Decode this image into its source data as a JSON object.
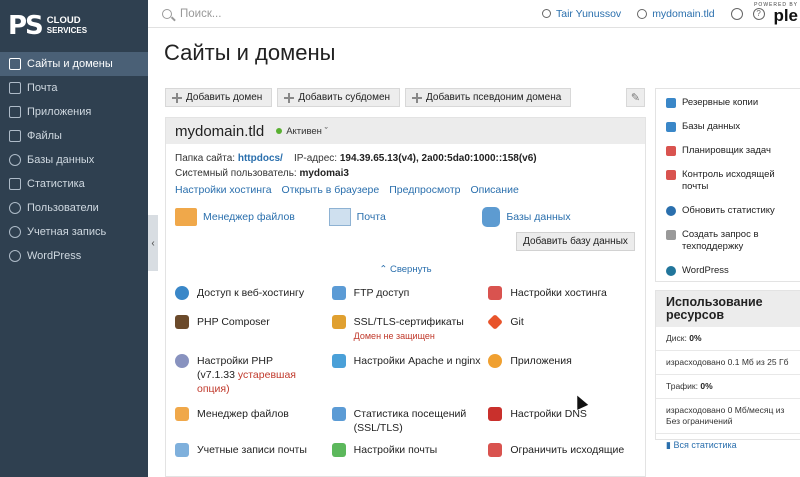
{
  "brand": {
    "logo_mark": "PS",
    "line1": "CLOUD",
    "line2": "SERVICES",
    "plesk_small": "POWERED BY",
    "plesk_big": "ple"
  },
  "sidebar": {
    "items": [
      {
        "label": "Сайты и домены",
        "icon": "monitor-icon",
        "active": true
      },
      {
        "label": "Почта",
        "icon": "mail-icon"
      },
      {
        "label": "Приложения",
        "icon": "apps-icon"
      },
      {
        "label": "Файлы",
        "icon": "folder-icon"
      },
      {
        "label": "Базы данных",
        "icon": "database-icon"
      },
      {
        "label": "Статистика",
        "icon": "chart-icon"
      },
      {
        "label": "Пользователи",
        "icon": "user-icon"
      },
      {
        "label": "Учетная запись",
        "icon": "account-icon"
      },
      {
        "label": "WordPress",
        "icon": "wordpress-icon"
      }
    ],
    "collapse_glyph": "‹"
  },
  "topbar": {
    "search_placeholder": "Поиск...",
    "user": "Tair Yunussov",
    "domain": "mydomain.tld",
    "help_glyph": "?"
  },
  "page": {
    "title": "Сайты и домены"
  },
  "toolbar": {
    "add_domain": "Добавить домен",
    "add_subdomain": "Добавить субдомен",
    "add_alias": "Добавить псевдоним домена"
  },
  "domain_card": {
    "name": "mydomain.tld",
    "status": "Активен",
    "folder_label": "Папка сайта:",
    "folder_value": "httpdocs/",
    "ip_label": "IP-адрес:",
    "ip_value": "194.39.65.13(v4), 2a00:5da0:1000::158(v6)",
    "sysuser_label": "Системный пользователь:",
    "sysuser_value": "mydomai3",
    "links": [
      "Настройки хостинга",
      "Открыть в браузере",
      "Предпросмотр",
      "Описание"
    ],
    "quick": [
      {
        "label": "Менеджер файлов",
        "icon": "folder-icon"
      },
      {
        "label": "Почта",
        "icon": "mail-icon"
      },
      {
        "label": "Базы данных",
        "icon": "database-icon"
      }
    ],
    "add_db": "Добавить базу данных",
    "collapse_label": "⌃ Свернуть",
    "tools": [
      [
        {
          "label": "Доступ к веб-хостингу",
          "icon": "globe-icon",
          "color": "#3a87c8"
        },
        {
          "label": "FTP доступ",
          "icon": "ftp-icon",
          "color": "#5b9bd5"
        },
        {
          "label": "Настройки хостинга",
          "icon": "hosting-icon",
          "color": "#d9534f"
        }
      ],
      [
        {
          "label": "PHP Composer",
          "icon": "composer-icon",
          "color": "#6b4a2b"
        },
        {
          "label": "SSL/TLS-сертификаты",
          "sub": "Домен не защищен",
          "icon": "lock-icon",
          "color": "#e0a030"
        },
        {
          "label": "Git",
          "icon": "git-icon",
          "color": "#e8542b"
        }
      ],
      [
        {
          "label": "Настройки PHP",
          "line2": "(v7.1.33 ",
          "warn": "устаревшая",
          "line3": "опция)",
          "icon": "php-icon",
          "color": "#8892bf"
        },
        {
          "label": "Настройки Apache и nginx",
          "icon": "apache-icon",
          "color": "#4aa0d8"
        },
        {
          "label": "Приложения",
          "icon": "apps-icon",
          "color": "#f0a030"
        }
      ],
      [
        {
          "label": "Менеджер файлов",
          "icon": "folder-icon",
          "color": "#f0a84a"
        },
        {
          "label": "Статистика посещений",
          "line2": "(SSL/TLS)",
          "icon": "stats-icon",
          "color": "#5b9bd5"
        },
        {
          "label": "Настройки DNS",
          "icon": "dns-icon",
          "color": "#c9302c"
        }
      ],
      [
        {
          "label": "Учетные записи почты",
          "icon": "mail-accounts-icon",
          "color": "#7fb0dc"
        },
        {
          "label": "Настройки почты",
          "icon": "mail-settings-icon",
          "color": "#5cb85c"
        },
        {
          "label": "Ограничить исходящие",
          "icon": "mail-limit-icon",
          "color": "#d9534f"
        }
      ]
    ]
  },
  "right_panel": {
    "items": [
      {
        "label": "Резервные копии",
        "icon": "backup-icon",
        "color": "#3a87c8"
      },
      {
        "label": "Базы данных",
        "icon": "database-icon",
        "color": "#3a87c8"
      },
      {
        "label": "Планировщик задач",
        "icon": "calendar-icon",
        "color": "#d9534f"
      },
      {
        "label": "Контроль исходящей почты",
        "icon": "mail-control-icon",
        "color": "#d9534f"
      },
      {
        "label": "Обновить статистику",
        "icon": "refresh-icon",
        "color": "#2a6fad"
      },
      {
        "label": "Создать запрос в техподдержку",
        "icon": "support-icon",
        "color": "#999999"
      },
      {
        "label": "WordPress",
        "icon": "wordpress-icon",
        "color": "#21759b"
      }
    ]
  },
  "usage": {
    "title": "Использование ресурсов",
    "disk_label": "Диск:",
    "disk_value": "0%",
    "disk_detail": "израсходовано 0.1 Мб из 25 Гб",
    "traffic_label": "Трафик:",
    "traffic_value": "0%",
    "traffic_detail": "израсходовано 0 Мб/месяц из Без ограничений",
    "all_stats": "Вся статистика"
  }
}
